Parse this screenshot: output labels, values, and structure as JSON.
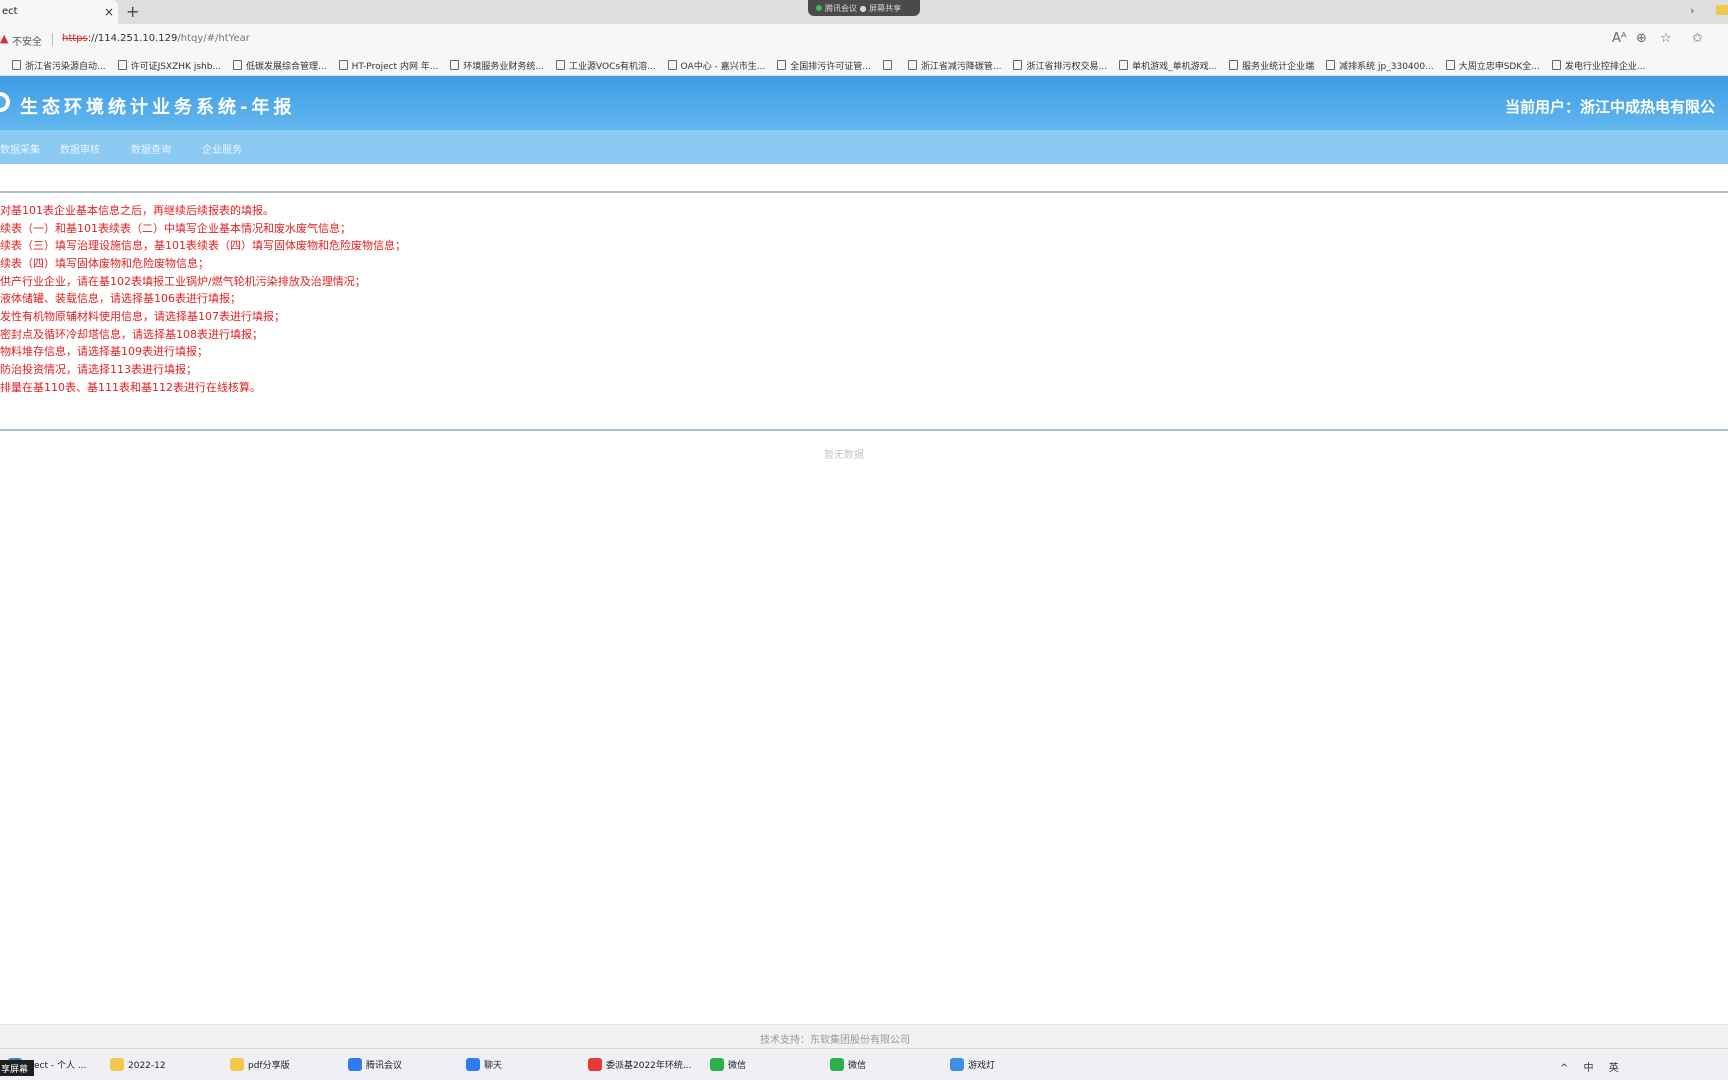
{
  "browser": {
    "tab_title": "ect",
    "tab_close": "×",
    "new_tab": "+",
    "meeting_indicator": "腾讯会议 ● 屏幕共享",
    "insecure_label": "不安全",
    "url_scheme": "https",
    "url_rest": "://114.251.10.129",
    "url_path": "/htqy/#/htYear",
    "bookmarks": [
      "浙江省污染源自动...",
      "许可证JSXZHK jshb...",
      "低碳发展综合管理...",
      "HT-Project 内网 年...",
      "环境服务业财务统...",
      "工业源VOCs有机溶...",
      "OA中心 - 嘉兴市生...",
      "全国排污许可证管...",
      "",
      "浙江省减污降碳管...",
      "浙江省排污权交易...",
      "单机游戏_单机游戏...",
      "服务业统计企业端",
      "减排系统 jp_330400...",
      "大周立忠申SDK全...",
      "发电行业控排企业..."
    ],
    "bookmarks_more": "›"
  },
  "header": {
    "app_title": "生态环境统计业务系统-年报",
    "current_user": "当前用户：浙江中成热电有限公"
  },
  "nav": {
    "items": [
      "数据采集",
      "数据审核",
      "数据查询",
      "企业服务"
    ]
  },
  "notice": {
    "lines": [
      "对基101表企业基本信息之后，再继续后续报表的填报。",
      "续表（一）和基101表续表（二）中填写企业基本情况和废水废气信息；",
      "续表（三）填写治理设施信息，基101表续表（四）填写固体废物和危险废物信息；",
      "续表（四）填写固体废物和危险废物信息；",
      "供产行业企业，请在基102表填报工业锅炉/燃气轮机污染排放及治理情况；",
      "液体储罐、装载信息，请选择基106表进行填报；",
      "发性有机物原辅材料使用信息，请选择基107表进行填报；",
      "密封点及循环冷却塔信息，请选择基108表进行填报；",
      "物料堆存信息，请选择基109表进行填报；",
      "防治投资情况，请选择113表进行填报；",
      "排量在基110表、基111表和基112表进行在线核算。"
    ]
  },
  "content": {
    "placeholder": "暂无数据"
  },
  "footer": {
    "text": "技术支持：东软集团股份有限公司"
  },
  "taskbar": {
    "share_badge": "享屏幕",
    "items": [
      {
        "label": "oject - 个人 ...",
        "color": "#3c7bd6"
      },
      {
        "label": "2022-12",
        "color": "#f2c94c"
      },
      {
        "label": "pdf分享版",
        "color": "#f2c94c"
      },
      {
        "label": "腾讯会议",
        "color": "#2d7cf0"
      },
      {
        "label": "聊天",
        "color": "#2d7cf0"
      },
      {
        "label": "委派基2022年环统...",
        "color": "#e53935"
      },
      {
        "label": "微信",
        "color": "#2ab04b"
      },
      {
        "label": "微信",
        "color": "#2ab04b"
      },
      {
        "label": "游戏灯",
        "color": "#3c8fe3"
      }
    ],
    "tray_text": "^ 中 英"
  }
}
